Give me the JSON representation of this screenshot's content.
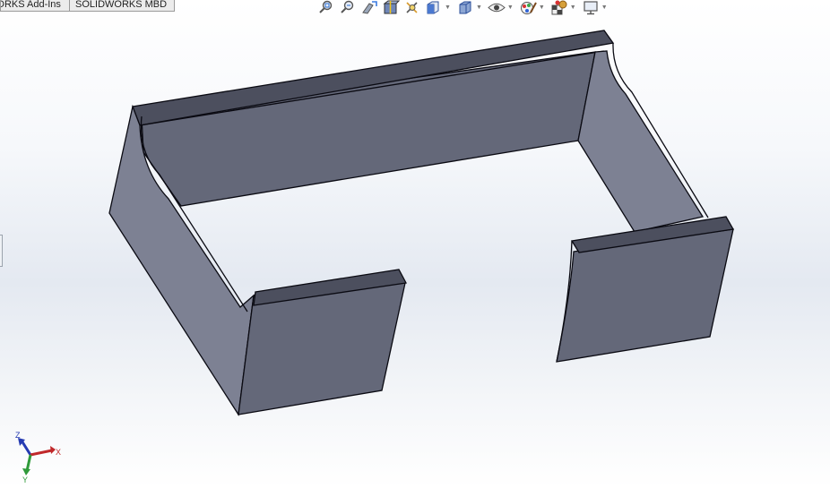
{
  "command_tabs": [
    {
      "label": "DRKS Add-Ins"
    },
    {
      "label": "SOLIDWORKS MBD"
    }
  ],
  "heads_up_toolbar": {
    "tools": [
      {
        "icon": "zoom-to-fit-icon"
      },
      {
        "icon": "zoom-to-area-icon"
      },
      {
        "icon": "previous-view-icon"
      },
      {
        "icon": "section-view-icon"
      },
      {
        "icon": "dynamic-annotation-views-icon"
      },
      {
        "icon": "view-orientation-icon",
        "dropdown": true
      },
      {
        "icon": "display-style-icon",
        "dropdown": true
      },
      {
        "icon": "hide-show-items-icon",
        "dropdown": true
      },
      {
        "icon": "edit-appearance-icon",
        "dropdown": true
      },
      {
        "icon": "apply-scene-icon",
        "dropdown": true
      },
      {
        "icon": "view-settings-icon",
        "dropdown": true
      }
    ]
  },
  "triad": {
    "x_label": "X",
    "y_label": "Y",
    "z_label": "Z"
  },
  "colors": {
    "part_top_face": "#4c4f5e",
    "part_front_face": "#646879",
    "part_side_face": "#7d8193",
    "edge_line": "#0a0a12",
    "triad_x": "#c0282a",
    "triad_y": "#2f9a3a",
    "triad_z": "#253bb2"
  }
}
